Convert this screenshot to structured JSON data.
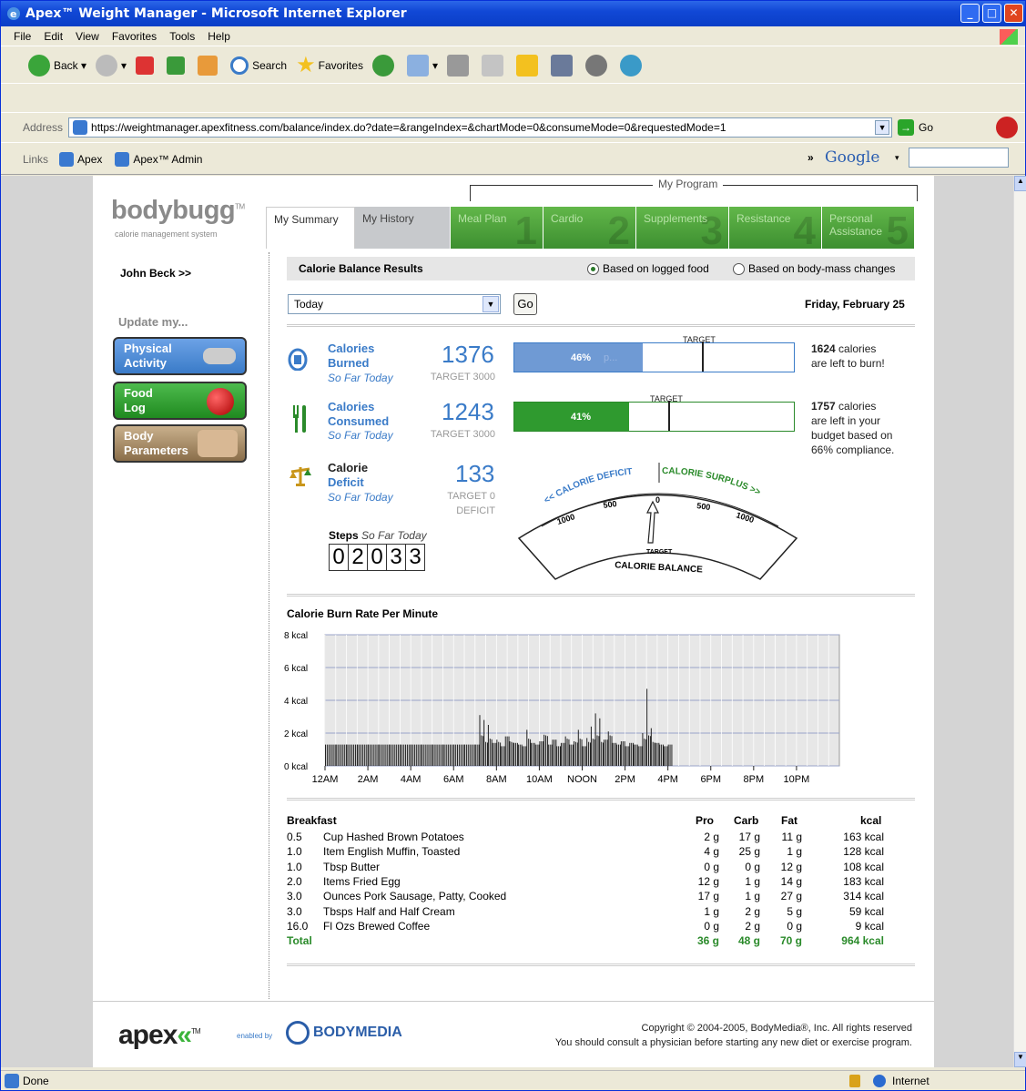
{
  "window": {
    "title": "Apex™ Weight Manager - Microsoft Internet Explorer"
  },
  "menu": [
    "File",
    "Edit",
    "View",
    "Favorites",
    "Tools",
    "Help"
  ],
  "toolbar": {
    "back": "Back",
    "search": "Search",
    "favorites": "Favorites"
  },
  "address": {
    "label": "Address",
    "url": "https://weightmanager.apexfitness.com/balance/index.do?date=&rangeIndex=&chartMode=0&consumeMode=0&requestedMode=1",
    "go": "Go"
  },
  "links": {
    "label": "Links",
    "items": [
      "Apex",
      "Apex™ Admin"
    ],
    "more": "»",
    "google": "Google"
  },
  "status": {
    "text": "Done",
    "zone": "Internet"
  },
  "brand": {
    "name": "bodybugg",
    "tm": "TM",
    "sub": "calorie management system"
  },
  "program_label": "My Program",
  "tabs": [
    {
      "label": "My Summary",
      "style": "active"
    },
    {
      "label": "My History",
      "style": "grey"
    },
    {
      "label": "Meal Plan",
      "style": "green",
      "num": "1"
    },
    {
      "label": "Cardio",
      "style": "green",
      "num": "2"
    },
    {
      "label": "Supplements",
      "style": "green",
      "num": "3"
    },
    {
      "label": "Resistance",
      "style": "green",
      "num": "4"
    },
    {
      "label": "Personal Assistance",
      "style": "green",
      "num": "5"
    }
  ],
  "sidebar": {
    "user": "John Beck >>",
    "update": "Update my...",
    "buttons": [
      "Physical Activity",
      "Food Log",
      "Body Parameters"
    ]
  },
  "results": {
    "title": "Calorie Balance Results",
    "radio1": "Based on logged food",
    "radio2": "Based on body-mass changes",
    "range": "Today",
    "go": "Go",
    "date": "Friday, February 25"
  },
  "metrics": {
    "burned": {
      "label1": "Calories",
      "label2": "Burned",
      "sub": "So Far Today",
      "value": "1376",
      "target": "TARGET 3000",
      "pct_label": "46%",
      "pct": 0.46,
      "target_pos": 0.67,
      "target_word": "TARGET",
      "faint": "p...",
      "right_num": "1624",
      "right_text": "calories",
      "right_text2": "are left to burn!"
    },
    "consumed": {
      "label1": "Calories",
      "label2": "Consumed",
      "sub": "So Far Today",
      "value": "1243",
      "target": "TARGET 3000",
      "pct_label": "41%",
      "pct": 0.41,
      "target_pos": 0.55,
      "target_word": "TARGET",
      "right_num": "1757",
      "right_text": "calories",
      "right_text2": "are left in your",
      "right_text3": "budget based on",
      "right_text4": "66% compliance."
    },
    "deficit": {
      "label1": "Calorie",
      "label2": "Deficit",
      "sub": "So Far Today",
      "value": "133",
      "target1": "TARGET 0",
      "target2": "DEFICIT"
    }
  },
  "gauge": {
    "left": "<< CALORIE DEFICIT",
    "right": "CALORIE SURPLUS >>",
    "ticks": [
      "1000",
      "500",
      "0",
      "500",
      "1000"
    ],
    "target": "TARGET",
    "title": "CALORIE BALANCE"
  },
  "steps": {
    "label": "Steps",
    "sub": "So Far Today",
    "digits": [
      "0",
      "2",
      "0",
      "3",
      "3"
    ]
  },
  "chart_data": {
    "type": "bar",
    "title": "Calorie Burn Rate Per Minute",
    "ylim": [
      0,
      8
    ],
    "yticks": [
      "0 kcal",
      "2 kcal",
      "4 kcal",
      "6 kcal",
      "8 kcal"
    ],
    "xticks": [
      "12AM",
      "2AM",
      "4AM",
      "6AM",
      "8AM",
      "10AM",
      "NOON",
      "2PM",
      "4PM",
      "6PM",
      "8PM",
      "10PM"
    ],
    "grid": true,
    "x_hours": [
      0.0,
      0.5,
      1.0,
      1.5,
      2.0,
      2.5,
      3.0,
      3.5,
      4.0,
      4.5,
      5.0,
      5.5,
      6.0,
      6.5,
      7.0,
      7.2,
      7.4,
      7.6,
      7.8,
      8.0,
      8.2,
      8.4,
      8.6,
      8.8,
      9.0,
      9.2,
      9.4,
      9.6,
      9.8,
      10.0,
      10.2,
      10.4,
      10.6,
      10.8,
      11.0,
      11.2,
      11.4,
      11.6,
      11.8,
      12.0,
      12.2,
      12.4,
      12.6,
      12.8,
      13.0,
      13.2,
      13.4,
      13.6,
      13.8,
      14.0,
      14.2,
      14.4,
      14.6,
      14.8,
      15.0,
      15.2,
      15.4,
      15.6,
      15.8,
      16.0
    ],
    "values": [
      1.3,
      1.3,
      1.3,
      1.3,
      1.3,
      1.3,
      1.3,
      1.3,
      1.3,
      1.3,
      1.3,
      1.3,
      1.3,
      1.3,
      1.3,
      3.1,
      2.8,
      2.5,
      1.4,
      1.6,
      1.2,
      1.8,
      1.5,
      1.4,
      1.3,
      1.2,
      2.2,
      1.4,
      1.3,
      1.5,
      1.9,
      1.3,
      1.6,
      1.2,
      1.4,
      1.8,
      1.3,
      1.5,
      2.2,
      1.2,
      1.7,
      2.4,
      3.2,
      2.9,
      1.6,
      2.1,
      1.4,
      1.3,
      1.5,
      1.2,
      1.4,
      1.3,
      1.2,
      2.0,
      4.7,
      2.3,
      1.4,
      1.3,
      1.2,
      1.3
    ]
  },
  "food": {
    "meal": "Breakfast",
    "headers": [
      "Pro",
      "Carb",
      "Fat",
      "kcal"
    ],
    "rows": [
      [
        "0.5",
        "Cup Hashed Brown Potatoes",
        "2 g",
        "17 g",
        "11 g",
        "163 kcal"
      ],
      [
        "1.0",
        "Item English Muffin, Toasted",
        "4 g",
        "25 g",
        "1 g",
        "128 kcal"
      ],
      [
        "1.0",
        "Tbsp Butter",
        "0 g",
        "0 g",
        "12 g",
        "108 kcal"
      ],
      [
        "2.0",
        "Items Fried Egg",
        "12 g",
        "1 g",
        "14 g",
        "183 kcal"
      ],
      [
        "3.0",
        "Ounces Pork Sausage, Patty, Cooked",
        "17 g",
        "1 g",
        "27 g",
        "314 kcal"
      ],
      [
        "3.0",
        "Tbsps Half and Half Cream",
        "1 g",
        "2 g",
        "5 g",
        "59 kcal"
      ],
      [
        "16.0",
        "Fl Ozs Brewed Coffee",
        "0 g",
        "2 g",
        "0 g",
        "9 kcal"
      ]
    ],
    "total": [
      "Total",
      "36 g",
      "48 g",
      "70 g",
      "964 kcal"
    ]
  },
  "footer": {
    "apex": "apex",
    "tm": "TM",
    "enabled": "enabled by",
    "bodymedia": "BODYMEDIA",
    "copy1": "Copyright © 2004-2005, BodyMedia®, Inc. All rights reserved",
    "copy2": "You should consult a physician before starting any new diet or exercise program."
  },
  "colors": {
    "accent": "#3a7bc8",
    "green": "#3d9a35",
    "physical": "#3a7bc8",
    "food": "#2f9a2f",
    "body": "#a08868"
  }
}
